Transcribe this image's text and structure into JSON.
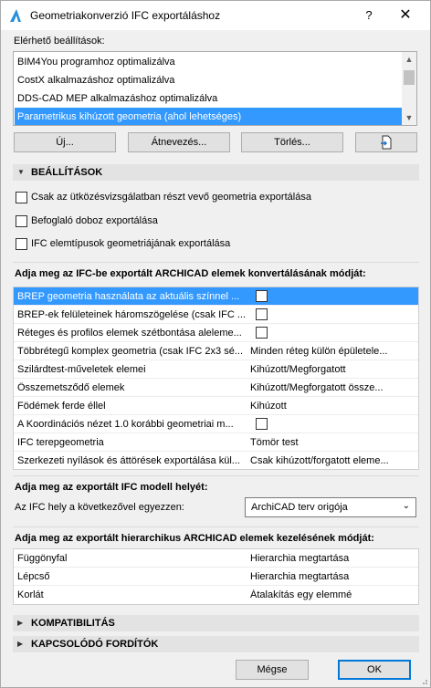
{
  "window": {
    "title": "Geometriakonverzió IFC exportáláshoz",
    "help_glyph": "?",
    "close_glyph": "✕"
  },
  "presets": {
    "label": "Elérhető beállítások:",
    "items": [
      "BIM4You programhoz optimalizálva",
      "CostX alkalmazáshoz optimalizálva",
      "DDS-CAD MEP alkalmazáshoz optimalizálva",
      "Parametrikus kihúzott geometria (ahol lehetséges)"
    ],
    "selected_index": 3
  },
  "buttons": {
    "new": "Új...",
    "rename": "Átnevezés...",
    "delete": "Törlés..."
  },
  "settings_section": {
    "title": "BEÁLLÍTÁSOK",
    "checkboxes": [
      "Csak az ütközésvizsgálatban részt vevő geometria exportálása",
      "Befoglaló doboz exportálása",
      "IFC elemtípusok geometriájának exportálása"
    ]
  },
  "conversion": {
    "label": "Adja meg az IFC-be exportált ARCHICAD elemek konvertálásának módját:",
    "rows": [
      {
        "name": "BREP geometria használata az aktuális színnel ...",
        "value": ""
      },
      {
        "name": "BREP-ek felületeinek háromszögelése (csak IFC ...",
        "value": ""
      },
      {
        "name": "Réteges és profilos elemek szétbontása aleleme...",
        "value": ""
      },
      {
        "name": "Többrétegű komplex geometria (csak IFC 2x3 sé...",
        "value": "Minden réteg külön épületele..."
      },
      {
        "name": "Szilárdtest-műveletek elemei",
        "value": "Kihúzott/Megforgatott"
      },
      {
        "name": "Összemetsződő elemek",
        "value": "Kihúzott/Megforgatott össze..."
      },
      {
        "name": "Födémek ferde éllel",
        "value": "Kihúzott"
      },
      {
        "name": "A Koordinációs nézet 1.0 korábbi geometriai m...",
        "value": ""
      },
      {
        "name": "IFC terepgeometria",
        "value": "Tömör test"
      },
      {
        "name": "Szerkezeti nyílások és áttörések exportálása kül...",
        "value": "Csak kihúzott/forgatott eleme..."
      }
    ]
  },
  "location": {
    "label": "Adja meg az exportált IFC modell helyét:",
    "field_label": "Az IFC hely a következővel egyezzen:",
    "selected": "ArchiCAD terv origója"
  },
  "hierarchy": {
    "label": "Adja meg az exportált hierarchikus ARCHICAD elemek kezelésének módját:",
    "rows": [
      {
        "name": "Függönyfal",
        "value": "Hierarchia megtartása"
      },
      {
        "name": "Lépcső",
        "value": "Hierarchia megtartása"
      },
      {
        "name": "Korlát",
        "value": "Átalakítás egy elemmé"
      }
    ]
  },
  "collapsed_sections": {
    "compat": "KOMPATIBILITÁS",
    "related": "KAPCSOLÓDÓ FORDÍTÓK"
  },
  "footer": {
    "cancel": "Mégse",
    "ok": "OK"
  },
  "colors": {
    "selection": "#3399ff",
    "primary_border": "#0078d7",
    "section_bg": "#e3e3e3"
  }
}
